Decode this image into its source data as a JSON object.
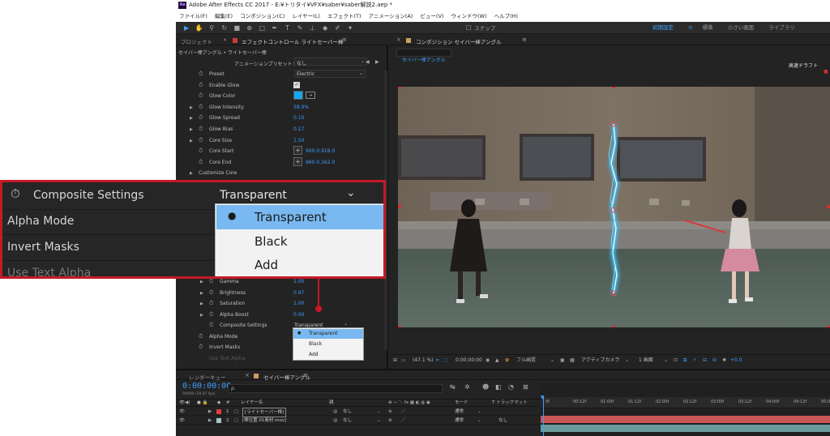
{
  "window": {
    "title": "Adobe After Effects CC 2017 - E:¥トリタイ¥VFX¥saber¥saber解説2.aep *",
    "logo_text": "Ae"
  },
  "menu": [
    "ファイル(F)",
    "編集(E)",
    "コンポジション(C)",
    "レイヤー(L)",
    "エフェクト(T)",
    "アニメーション(A)",
    "ビュー(V)",
    "ウィンドウ(W)",
    "ヘルプ(H)"
  ],
  "toolbar": {
    "snap_label": "スナップ",
    "workspaces": [
      "初期設定",
      "標準",
      "小さい画面",
      "ライブラリ"
    ],
    "active_workspace": "初期設定"
  },
  "effect_panel": {
    "project_tab": "プロジェクト",
    "effect_tab": "エフェクトコントロール ライトセーバー棒",
    "breadcrumb": "セイバー棒アングル • ライトセーバー棒",
    "preset_label": "アニメーションプリセット：",
    "preset_value": "なし",
    "rows": [
      {
        "label": "Preset",
        "value": "Electric",
        "kind": "dropdown"
      },
      {
        "label": "Enable Glow",
        "value": "",
        "kind": "checkbox"
      },
      {
        "label": "Glow Color",
        "value": "",
        "kind": "color",
        "color": "#17a7f2"
      },
      {
        "label": "Glow Intensity",
        "value": "58.0%",
        "kind": "value",
        "twirl": true
      },
      {
        "label": "Glow Spread",
        "value": "0.10",
        "kind": "value",
        "twirl": true
      },
      {
        "label": "Glow Bias",
        "value": "0.17",
        "kind": "value",
        "twirl": true
      },
      {
        "label": "Core Size",
        "value": "1.50",
        "kind": "value",
        "twirl": true
      },
      {
        "label": "Core Start",
        "value": "960.0,918.0",
        "kind": "point"
      },
      {
        "label": "Core End",
        "value": "960.0,162.0",
        "kind": "point"
      }
    ],
    "customize_core": "Customize Core",
    "lower_rows": [
      {
        "label": "Gamma",
        "value": "1.00"
      },
      {
        "label": "Brightness",
        "value": "0.97"
      },
      {
        "label": "Saturation",
        "value": "1.00"
      },
      {
        "label": "Alpha Boost",
        "value": "0.00"
      }
    ],
    "composite_label": "Composite Settings",
    "composite_value": "Transparent",
    "alpha_mode": "Alpha Mode",
    "invert_masks": "Invert Masks",
    "use_text_alpha": "Use Text Alpha",
    "options": [
      "Transparent",
      "Black",
      "Add"
    ],
    "selected_option": "Transparent"
  },
  "composition": {
    "tab_label": "コンポジション セイバー棒アングル",
    "sub_tab": "セイバー棒アングル",
    "draft_label": "高速ドラフト",
    "footer": {
      "zoom": "(47.1 %)",
      "timecode": "0;00;00;00",
      "resolution": "フル画質",
      "camera": "アクティブカメラ",
      "views": "1 画面",
      "exposure": "+0.0"
    }
  },
  "timeline": {
    "render_tab": "レンダーキュー",
    "comp_tab": "セイバー棒アングル",
    "timecode": "0:00:00:00",
    "fps": "00000 (29.97 fps)",
    "search_placeholder": "ρ.",
    "columns": {
      "layer_name": "レイヤー名",
      "parent": "親",
      "mode": "モード",
      "trackmatte": "T  トラックマット"
    },
    "ruler": [
      "0f",
      "00:12f",
      "01:00f",
      "01:12f",
      "02:00f",
      "02:12f",
      "03:00f",
      "03:12f",
      "04:00f",
      "04:12f",
      "05:00"
    ],
    "layers": [
      {
        "num": "1",
        "name": "[ライトセーバー棒]",
        "parent": "なし",
        "mode": "通常",
        "matte": "",
        "label_color": "#e33c3c",
        "bar_color": "#c95656"
      },
      {
        "num": "2",
        "name": "[棒位置 01素材.mov]",
        "parent": "なし",
        "mode": "通常",
        "matte": "なし",
        "label_color": "#a7c3c7",
        "bar_color": "#6a9a9e"
      }
    ]
  },
  "callout": {
    "composite_label": "Composite Settings",
    "composite_value": "Transparent",
    "alpha_mode": "Alpha Mode",
    "invert_masks": "Invert Masks",
    "use_text_alpha": "Use Text Alpha",
    "options": [
      "Transparent",
      "Black",
      "Add"
    ]
  },
  "colors": {
    "accent": "#3f9cff",
    "callout_border": "#c61926",
    "selection": "#79b8f0"
  }
}
